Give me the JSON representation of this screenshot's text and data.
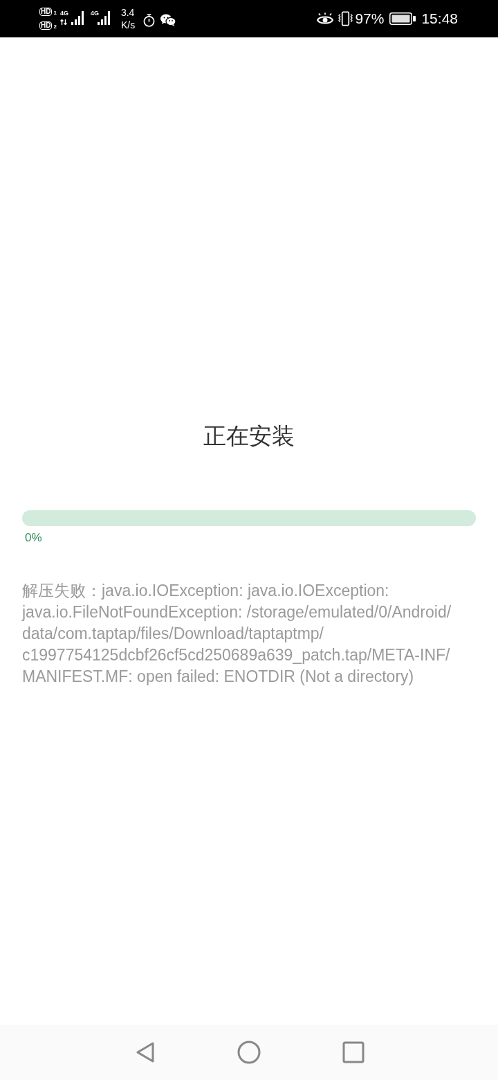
{
  "status_bar": {
    "sim_badges": [
      {
        "label": "HD",
        "slot": "1"
      },
      {
        "label": "HD",
        "slot": "2"
      }
    ],
    "signals": [
      {
        "network": "4G",
        "data_activity": true
      },
      {
        "network": "4G",
        "data_activity": false
      }
    ],
    "speed": "3.4",
    "speed_unit": "K/s",
    "battery_percent": "97%",
    "time": "15:48"
  },
  "install": {
    "title": "正在安装",
    "progress": {
      "level": 0,
      "label": "0%"
    },
    "error_message": "解压失败：java.io.IOException: java.io.IOException: java.io.FileNotFoundException: /storage/emulated/0/Android/data/com.taptap/files/Download/taptaptmp/c1997754125dcbf26cf5cd250689a639_patch.tap/META-INF/MANIFEST.MF: open failed: ENOTDIR (Not a directory)"
  },
  "nav_bar": {
    "buttons": [
      {
        "kind": "back"
      },
      {
        "kind": "home"
      },
      {
        "kind": "recents"
      }
    ]
  }
}
